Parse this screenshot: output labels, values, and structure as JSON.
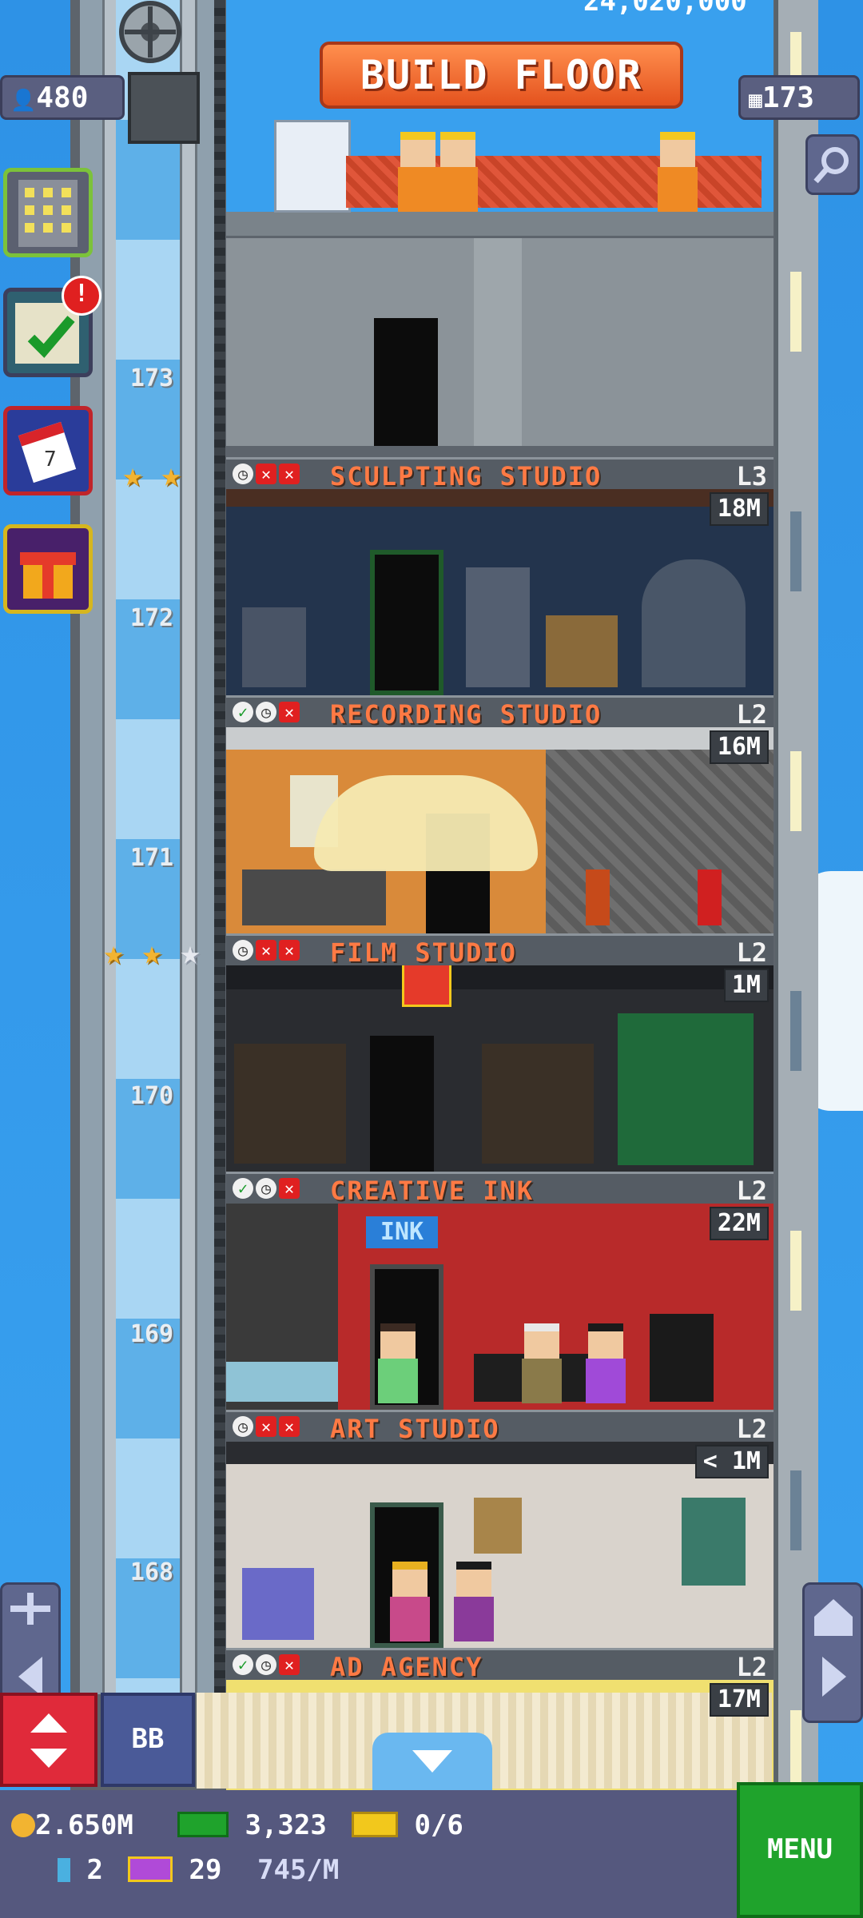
{
  "top": {
    "build_floor_label": "BUILD FLOOR",
    "total_coins_partial": "24,020,000",
    "population": "480",
    "floor_count": "173"
  },
  "floors": [
    {
      "number": "173",
      "name": "SCULPTING STUDIO",
      "level": "L3",
      "income": "18M",
      "status_icons": [
        "clock",
        "x",
        "x"
      ],
      "stars": 2,
      "max_stars": 2
    },
    {
      "number": "172",
      "name": "RECORDING STUDIO",
      "level": "L2",
      "income": "16M",
      "status_icons": [
        "check",
        "clock",
        "x"
      ]
    },
    {
      "number": "171",
      "name": "FILM STUDIO",
      "level": "L2",
      "income": "1M",
      "status_icons": [
        "clock",
        "x",
        "x"
      ],
      "stars": 2,
      "max_stars": 3
    },
    {
      "number": "170",
      "name": "CREATIVE INK",
      "level": "L2",
      "income": "22M",
      "status_icons": [
        "check",
        "clock",
        "x"
      ],
      "sign": "INK"
    },
    {
      "number": "169",
      "name": "ART STUDIO",
      "level": "L2",
      "income": "< 1M",
      "status_icons": [
        "clock",
        "x",
        "x"
      ]
    },
    {
      "number": "168",
      "name": "AD AGENCY",
      "level": "L2",
      "income": "17M",
      "status_icons": [
        "check",
        "clock",
        "x"
      ]
    }
  ],
  "bottom": {
    "coins": "2.650M",
    "bux": "3,323",
    "tickets": "0/6",
    "keys": "2",
    "vip": "29",
    "rate": "745/M",
    "bb_label": "BB",
    "menu_label": "MENU"
  },
  "colors": {
    "sky": "#3a9ae8",
    "build_button": "#f26a2f",
    "floor_name": "#ff7a44",
    "menu": "#1fa32c",
    "elevator_button": "#e02a3a"
  },
  "icons": {
    "population": "person-icon",
    "floors": "building-icon",
    "search": "magnifier-icon",
    "coin": "coin-icon",
    "bux": "cash-icon",
    "ticket": "ticket-icon",
    "key": "key-icon",
    "vip": "vip-icon"
  }
}
